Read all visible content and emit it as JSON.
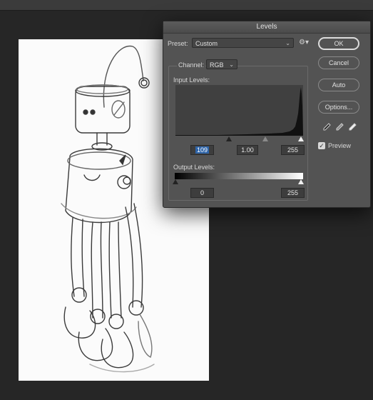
{
  "dialog": {
    "title": "Levels",
    "preset_label": "Preset:",
    "preset_value": "Custom",
    "channel_label": "Channel:",
    "channel_value": "RGB",
    "input_levels_label": "Input Levels:",
    "input_black": "109",
    "input_gamma": "1.00",
    "input_white": "255",
    "output_levels_label": "Output Levels:",
    "output_black": "0",
    "output_white": "255",
    "buttons": {
      "ok": "OK",
      "cancel": "Cancel",
      "auto": "Auto",
      "options": "Options..."
    },
    "preview_label": "Preview",
    "preview_checked": true
  },
  "icons": {
    "preset_menu": "gear-icon",
    "dropdown": "chevron-down-icon",
    "black_eyedropper": "eyedropper-icon",
    "gray_eyedropper": "eyedropper-icon",
    "white_eyedropper": "eyedropper-icon"
  },
  "colors": {
    "app_background": "#262626",
    "dialog_background": "#535353",
    "canvas_background": "#fbfbfb",
    "text_highlight": "#2e64a8"
  }
}
